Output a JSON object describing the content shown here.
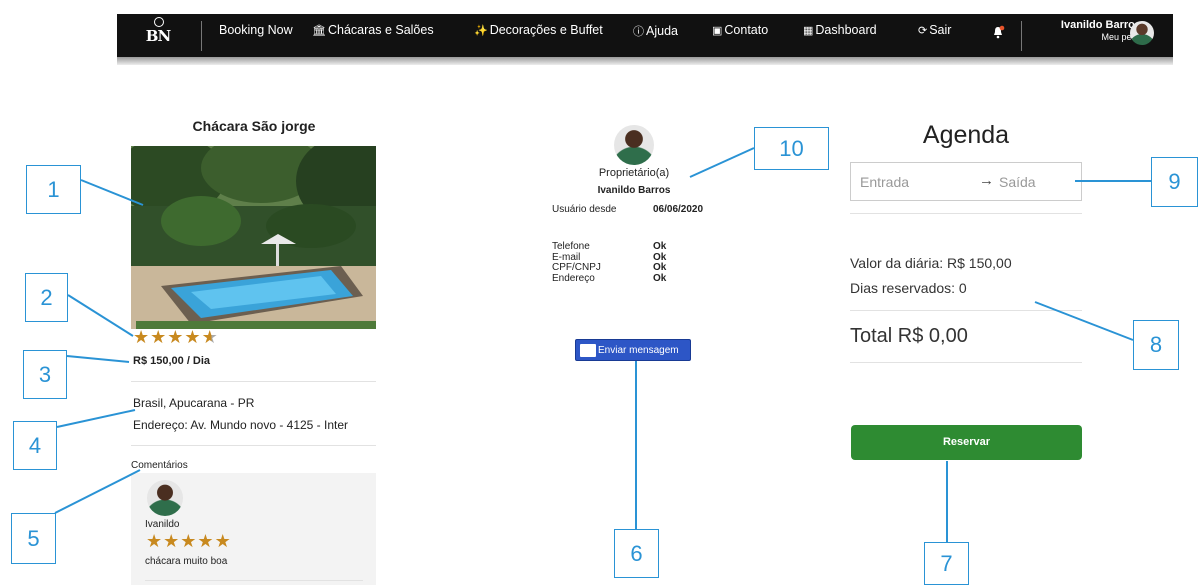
{
  "navbar": {
    "logo_text": "BN",
    "items": [
      {
        "label": "Booking Now",
        "icon": ""
      },
      {
        "label": "Chácaras e Salões",
        "icon": "building-icon"
      },
      {
        "label": "Decorações e Buffet",
        "icon": "sparkle-icon"
      },
      {
        "label": "Ajuda",
        "icon": "help-icon"
      },
      {
        "label": "Contato",
        "icon": "contact-icon"
      },
      {
        "label": "Dashboard",
        "icon": "dashboard-icon"
      },
      {
        "label": "Sair",
        "icon": "logout-icon"
      }
    ],
    "user_name": "Ivanildo Barros",
    "user_profile_label": "Meu perfil"
  },
  "listing": {
    "title": "Chácara São jorge",
    "rating": 4.5,
    "price_label": "R$ 150,00 / Dia",
    "location": "Brasil, Apucarana - PR",
    "address": "Endereço: Av. Mundo novo - 4125 - Inter",
    "comments_label": "Comentários",
    "comments": [
      {
        "author": "Ivanildo",
        "rating": 5,
        "text": "chácara muito boa"
      }
    ]
  },
  "owner": {
    "role": "Proprietário(a)",
    "name": "Ivanildo Barros",
    "since_label": "Usuário desde",
    "since_value": "06/06/2020",
    "verifications": [
      {
        "label": "Telefone",
        "value": "Ok"
      },
      {
        "label": "E-mail",
        "value": "Ok"
      },
      {
        "label": "CPF/CNPJ",
        "value": "Ok"
      },
      {
        "label": "Endereço",
        "value": "Ok"
      }
    ],
    "message_button": "Enviar mensagem"
  },
  "booking": {
    "heading": "Agenda",
    "checkin_placeholder": "Entrada",
    "checkout_placeholder": "Saída",
    "daily_rate": "Valor da diária: R$ 150,00",
    "days_reserved": "Dias reservados: 0",
    "total": "Total R$ 0,00",
    "reserve_button": "Reservar"
  },
  "callouts": [
    "1",
    "2",
    "3",
    "4",
    "5",
    "6",
    "7",
    "8",
    "9",
    "10"
  ],
  "colors": {
    "navbar": "#111111",
    "accent_green": "#2e8b32",
    "message_blue": "#2d56c6",
    "callout_blue": "#2a93d5",
    "star": "#c8891f"
  }
}
